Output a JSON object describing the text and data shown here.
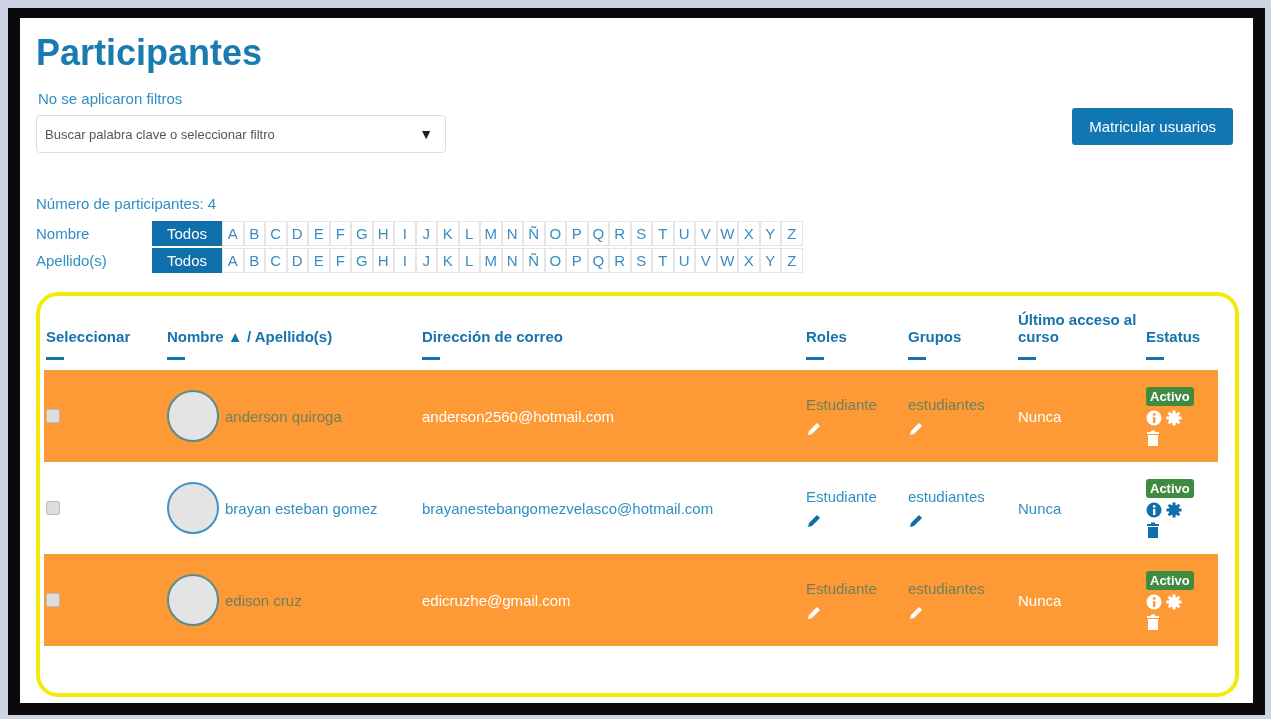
{
  "title": "Participantes",
  "filter_status": "No se aplicaron filtros",
  "filter_select": {
    "placeholder": "Buscar palabra clave o seleccionar filtro",
    "arrow": "▼"
  },
  "enrol_button": "Matricular usuarios",
  "participant_count": "Número de participantes: 4",
  "initials_bars": [
    {
      "label": "Nombre",
      "items": [
        {
          "label": "Todos",
          "selected": true
        },
        {
          "label": "A",
          "selected": false
        },
        {
          "label": "B",
          "selected": false
        },
        {
          "label": "C",
          "selected": false
        },
        {
          "label": "D",
          "selected": false
        },
        {
          "label": "E",
          "selected": false
        },
        {
          "label": "F",
          "selected": false
        },
        {
          "label": "G",
          "selected": false
        },
        {
          "label": "H",
          "selected": false
        },
        {
          "label": "I",
          "selected": false
        },
        {
          "label": "J",
          "selected": false
        },
        {
          "label": "K",
          "selected": false
        },
        {
          "label": "L",
          "selected": false
        },
        {
          "label": "M",
          "selected": false
        },
        {
          "label": "N",
          "selected": false
        },
        {
          "label": "Ñ",
          "selected": false
        },
        {
          "label": "O",
          "selected": false
        },
        {
          "label": "P",
          "selected": false
        },
        {
          "label": "Q",
          "selected": false
        },
        {
          "label": "R",
          "selected": false
        },
        {
          "label": "S",
          "selected": false
        },
        {
          "label": "T",
          "selected": false
        },
        {
          "label": "U",
          "selected": false
        },
        {
          "label": "V",
          "selected": false
        },
        {
          "label": "W",
          "selected": false
        },
        {
          "label": "X",
          "selected": false
        },
        {
          "label": "Y",
          "selected": false
        },
        {
          "label": "Z",
          "selected": false
        }
      ]
    },
    {
      "label": "Apellido(s)",
      "items": [
        {
          "label": "Todos",
          "selected": true
        },
        {
          "label": "A",
          "selected": false
        },
        {
          "label": "B",
          "selected": false
        },
        {
          "label": "C",
          "selected": false
        },
        {
          "label": "D",
          "selected": false
        },
        {
          "label": "E",
          "selected": false
        },
        {
          "label": "F",
          "selected": false
        },
        {
          "label": "G",
          "selected": false
        },
        {
          "label": "H",
          "selected": false
        },
        {
          "label": "I",
          "selected": false
        },
        {
          "label": "J",
          "selected": false
        },
        {
          "label": "K",
          "selected": false
        },
        {
          "label": "L",
          "selected": false
        },
        {
          "label": "M",
          "selected": false
        },
        {
          "label": "N",
          "selected": false
        },
        {
          "label": "Ñ",
          "selected": false
        },
        {
          "label": "O",
          "selected": false
        },
        {
          "label": "P",
          "selected": false
        },
        {
          "label": "Q",
          "selected": false
        },
        {
          "label": "R",
          "selected": false
        },
        {
          "label": "S",
          "selected": false
        },
        {
          "label": "T",
          "selected": false
        },
        {
          "label": "U",
          "selected": false
        },
        {
          "label": "V",
          "selected": false
        },
        {
          "label": "W",
          "selected": false
        },
        {
          "label": "X",
          "selected": false
        },
        {
          "label": "Y",
          "selected": false
        },
        {
          "label": "Z",
          "selected": false
        }
      ]
    }
  ],
  "table": {
    "columns": [
      {
        "label": "Seleccionar"
      },
      {
        "label": "Nombre",
        "sort_arrow": "▲",
        "label_2": "/ Apellido(s)"
      },
      {
        "label": "Dirección de correo"
      },
      {
        "label": "Roles"
      },
      {
        "label": "Grupos"
      },
      {
        "label": "Último acceso al curso"
      },
      {
        "label": "Estatus"
      }
    ],
    "rows": [
      {
        "highlighted": true,
        "checked": false,
        "name": "anderson quiroga",
        "email": "anderson2560@hotmail.com",
        "role": "Estudiante",
        "group": "estudiantes",
        "last_access": "Nunca",
        "status": "Activo"
      },
      {
        "highlighted": false,
        "checked": false,
        "name": "brayan esteban gomez",
        "email": "brayanestebangomezvelasco@hotmail.com",
        "role": "Estudiante",
        "group": "estudiantes",
        "last_access": "Nunca",
        "status": "Activo"
      },
      {
        "highlighted": true,
        "checked": false,
        "name": "edison cruz",
        "email": "edicruzhe@gmail.com",
        "role": "Estudiante",
        "group": "estudiantes",
        "last_access": "Nunca",
        "status": "Activo"
      }
    ]
  }
}
